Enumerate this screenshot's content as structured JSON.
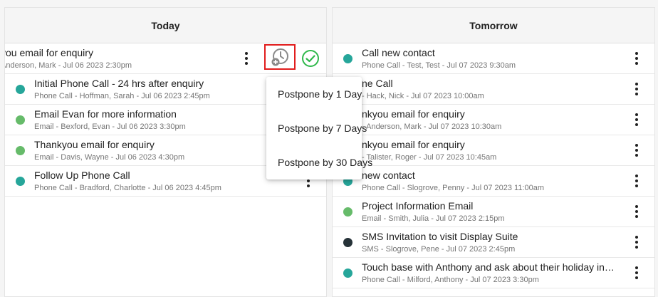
{
  "columns": {
    "today": {
      "title": "Today",
      "rows": [
        {
          "title": "you email for enquiry",
          "sub": "Anderson, Mark - Jul 06 2023 2:30pm",
          "dot": ""
        },
        {
          "title": "Initial Phone Call - 24 hrs after enquiry",
          "sub": "Phone Call - Hoffman, Sarah - Jul 06 2023 2:45pm",
          "dot": "#26a69a"
        },
        {
          "title": "Email Evan for more information",
          "sub": "Email - Bexford, Evan - Jul 06 2023 3:30pm",
          "dot": "#66bb6a"
        },
        {
          "title": "Thankyou email for enquiry",
          "sub": "Email - Davis, Wayne - Jul 06 2023 4:30pm",
          "dot": "#66bb6a"
        },
        {
          "title": "Follow Up Phone Call",
          "sub": "Phone Call - Bradford, Charlotte - Jul 06 2023 4:45pm",
          "dot": "#26a69a"
        }
      ]
    },
    "tomorrow": {
      "title": "Tomorrow",
      "rows": [
        {
          "title": "Call new contact",
          "sub": "Phone Call - Test, Test - Jul 07 2023 9:30am",
          "dot": "#26a69a"
        },
        {
          "title": "ne Call",
          "sub": "- Hack, Nick - Jul 07 2023 10:00am",
          "dot": "#26a69a"
        },
        {
          "title": "nkyou email for enquiry",
          "sub": "- Anderson, Mark - Jul 07 2023 10:30am",
          "dot": "#66bb6a"
        },
        {
          "title": "nkyou email for enquiry",
          "sub": "- Talister, Roger - Jul 07 2023 10:45am",
          "dot": "#66bb6a"
        },
        {
          "title": "new contact",
          "sub": "Phone Call - Slogrove, Penny - Jul 07 2023 11:00am",
          "dot": "#26a69a"
        },
        {
          "title": "Project Information Email",
          "sub": "Email - Smith, Julia - Jul 07 2023 2:15pm",
          "dot": "#66bb6a"
        },
        {
          "title": "SMS Invitation to visit Display Suite",
          "sub": "SMS - Slogrove, Pene - Jul 07 2023 2:45pm",
          "dot": "#263238"
        },
        {
          "title": "Touch base with Anthony and ask about their holiday in…",
          "sub": "Phone Call - Milford, Anthony - Jul 07 2023 3:30pm",
          "dot": "#26a69a"
        }
      ]
    }
  },
  "postpone_menu": {
    "items": [
      "Postpone by 1 Day",
      "Postpone by 7 Days",
      "Postpone by 30 Days"
    ]
  },
  "icons": {
    "postpone": "clock-plus-icon",
    "complete": "check-circle-icon",
    "more": "kebab-icon"
  },
  "colors": {
    "phone_call": "#26a69a",
    "email": "#66bb6a",
    "sms": "#263238",
    "highlight": "#e11d1d",
    "complete": "#2eb84a"
  }
}
